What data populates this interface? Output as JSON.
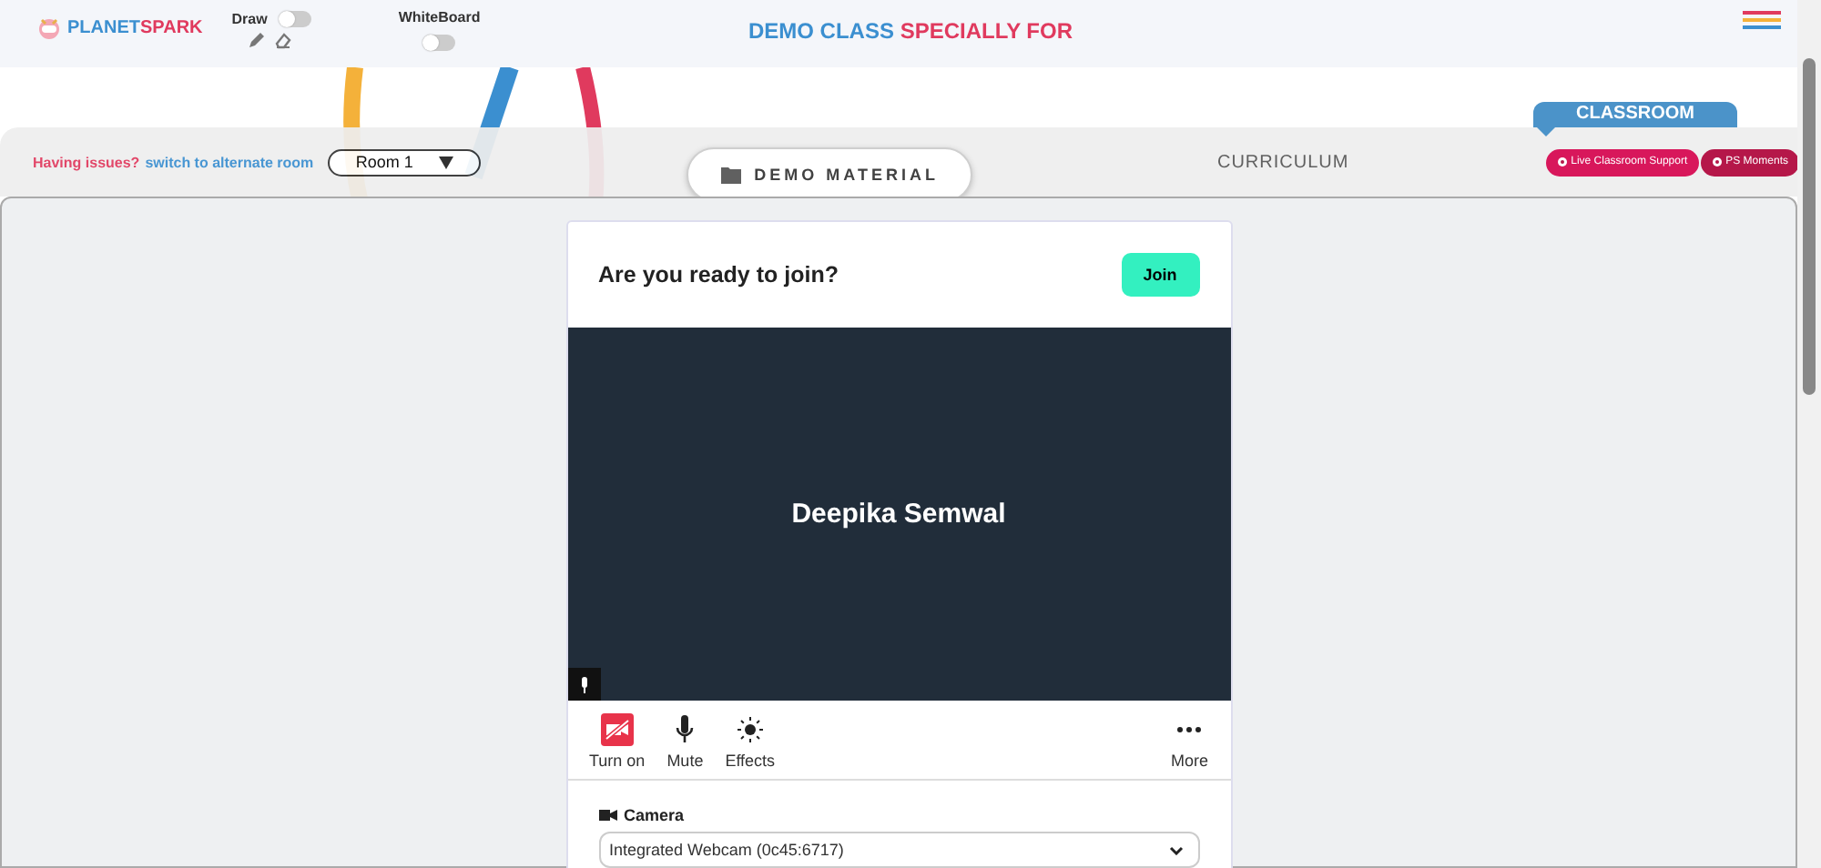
{
  "header": {
    "logo": {
      "text_1": "PLANET",
      "text_2": "SPARK"
    },
    "draw": {
      "label": "Draw",
      "on": false
    },
    "whiteboard": {
      "label": "WhiteBoard",
      "on": false
    },
    "title_1": "DEMO CLASS",
    "title_2": "SPECIALLY FOR"
  },
  "toolbar": {
    "issue_text": "Having issues?",
    "switch_link": "switch to alternate room",
    "room": "Room 1",
    "tabs": [
      {
        "label": "DEMO MATERIAL",
        "selected": true
      },
      {
        "label": "CURRICULUM",
        "selected": false
      }
    ],
    "classroom_tab": "CLASSROOM",
    "buttons": [
      "Live Classroom Support",
      "PS Moments"
    ]
  },
  "join_card": {
    "prompt": "Are you ready to join?",
    "join_button": "Join",
    "participant": "Deepika Semwal",
    "controls": [
      {
        "kind": "camera",
        "label": "Turn on",
        "off": true
      },
      {
        "kind": "mic",
        "label": "Mute"
      },
      {
        "kind": "effects",
        "label": "Effects"
      },
      {
        "kind": "more",
        "label": "More"
      }
    ],
    "camera_label": "Camera",
    "camera_value": "Integrated Webcam (0c45:6717)"
  }
}
